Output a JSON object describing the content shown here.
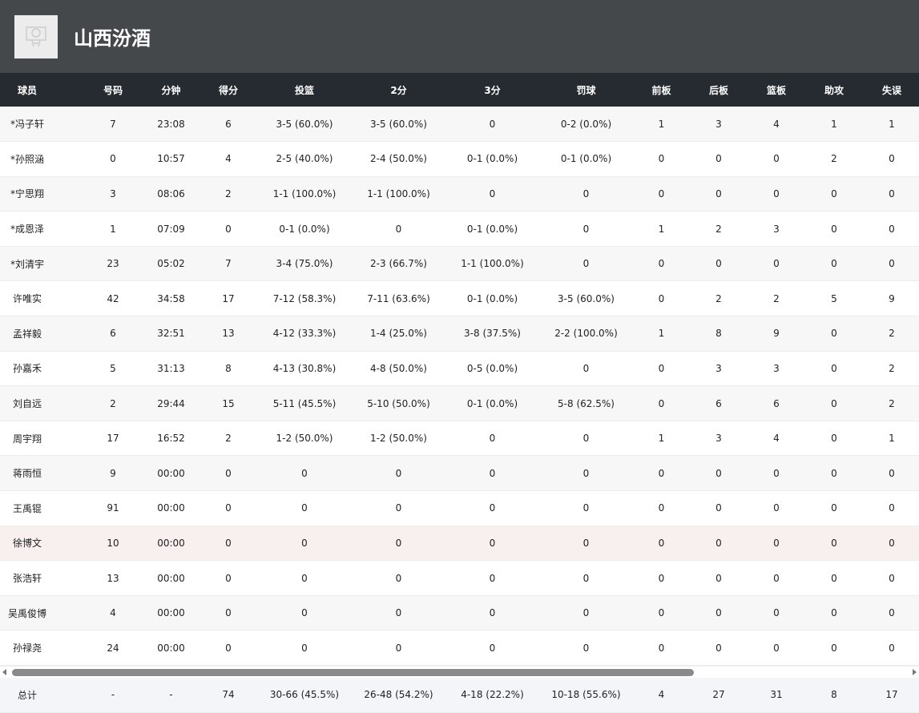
{
  "team": {
    "name": "山西汾酒"
  },
  "columns": [
    "球员",
    "号码",
    "分钟",
    "得分",
    "投篮",
    "2分",
    "3分",
    "罚球",
    "前板",
    "后板",
    "篮板",
    "助攻",
    "失误"
  ],
  "rows": [
    [
      "*冯子轩",
      "7",
      "23:08",
      "6",
      "3-5 (60.0%)",
      "3-5 (60.0%)",
      "0",
      "0-2 (0.0%)",
      "1",
      "3",
      "4",
      "1",
      "1"
    ],
    [
      "*孙照涵",
      "0",
      "10:57",
      "4",
      "2-5 (40.0%)",
      "2-4 (50.0%)",
      "0-1 (0.0%)",
      "0-1 (0.0%)",
      "0",
      "0",
      "0",
      "2",
      "0"
    ],
    [
      "*宁思翔",
      "3",
      "08:06",
      "2",
      "1-1 (100.0%)",
      "1-1 (100.0%)",
      "0",
      "0",
      "0",
      "0",
      "0",
      "0",
      "0"
    ],
    [
      "*成恩泽",
      "1",
      "07:09",
      "0",
      "0-1 (0.0%)",
      "0",
      "0-1 (0.0%)",
      "0",
      "1",
      "2",
      "3",
      "0",
      "0"
    ],
    [
      "*刘清宇",
      "23",
      "05:02",
      "7",
      "3-4 (75.0%)",
      "2-3 (66.7%)",
      "1-1 (100.0%)",
      "0",
      "0",
      "0",
      "0",
      "0",
      "0"
    ],
    [
      "许唯实",
      "42",
      "34:58",
      "17",
      "7-12 (58.3%)",
      "7-11 (63.6%)",
      "0-1 (0.0%)",
      "3-5 (60.0%)",
      "0",
      "2",
      "2",
      "5",
      "9"
    ],
    [
      "孟祥毅",
      "6",
      "32:51",
      "13",
      "4-12 (33.3%)",
      "1-4 (25.0%)",
      "3-8 (37.5%)",
      "2-2 (100.0%)",
      "1",
      "8",
      "9",
      "0",
      "2"
    ],
    [
      "孙嘉禾",
      "5",
      "31:13",
      "8",
      "4-13 (30.8%)",
      "4-8 (50.0%)",
      "0-5 (0.0%)",
      "0",
      "0",
      "3",
      "3",
      "0",
      "2"
    ],
    [
      "刘自远",
      "2",
      "29:44",
      "15",
      "5-11 (45.5%)",
      "5-10 (50.0%)",
      "0-1 (0.0%)",
      "5-8 (62.5%)",
      "0",
      "6",
      "6",
      "0",
      "2"
    ],
    [
      "周宇翔",
      "17",
      "16:52",
      "2",
      "1-2 (50.0%)",
      "1-2 (50.0%)",
      "0",
      "0",
      "1",
      "3",
      "4",
      "0",
      "1"
    ],
    [
      "蒋雨恒",
      "9",
      "00:00",
      "0",
      "0",
      "0",
      "0",
      "0",
      "0",
      "0",
      "0",
      "0",
      "0"
    ],
    [
      "王禹锟",
      "91",
      "00:00",
      "0",
      "0",
      "0",
      "0",
      "0",
      "0",
      "0",
      "0",
      "0",
      "0"
    ],
    [
      "徐博文",
      "10",
      "00:00",
      "0",
      "0",
      "0",
      "0",
      "0",
      "0",
      "0",
      "0",
      "0",
      "0"
    ],
    [
      "张浩轩",
      "13",
      "00:00",
      "0",
      "0",
      "0",
      "0",
      "0",
      "0",
      "0",
      "0",
      "0",
      "0"
    ],
    [
      "吴禹俊博",
      "4",
      "00:00",
      "0",
      "0",
      "0",
      "0",
      "0",
      "0",
      "0",
      "0",
      "0",
      "0"
    ],
    [
      "孙禄尧",
      "24",
      "00:00",
      "0",
      "0",
      "0",
      "0",
      "0",
      "0",
      "0",
      "0",
      "0",
      "0"
    ]
  ],
  "totals": [
    "总计",
    "-",
    "-",
    "74",
    "30-66 (45.5%)",
    "26-48 (54.2%)",
    "4-18 (22.2%)",
    "10-18 (55.6%)",
    "4",
    "27",
    "31",
    "8",
    "17"
  ]
}
